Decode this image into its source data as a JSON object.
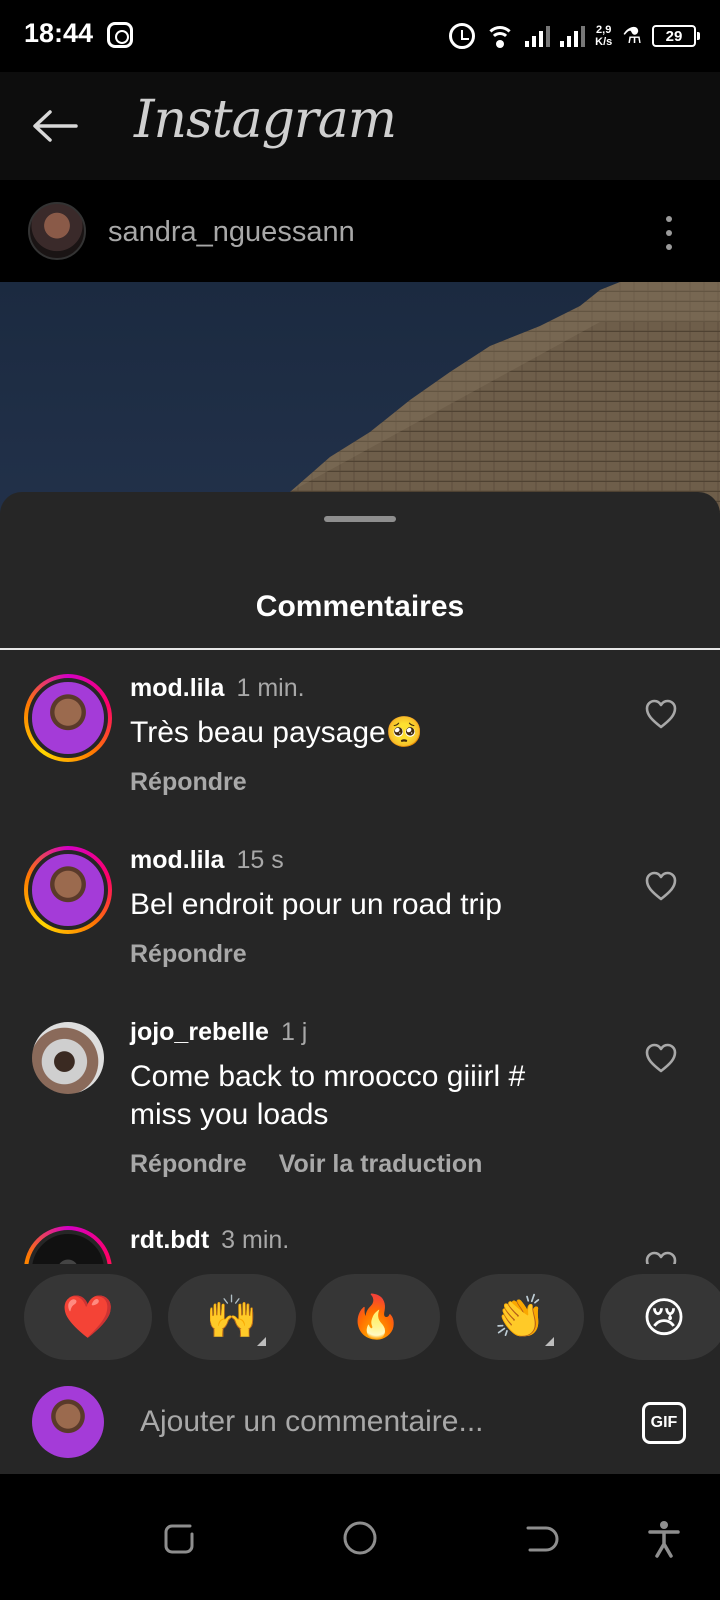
{
  "status_bar": {
    "time": "18:44",
    "net_speed_value": "2,9",
    "net_speed_unit": "K/s",
    "battery": "29"
  },
  "app": {
    "title": "Instagram"
  },
  "post": {
    "username": "sandra_nguessann"
  },
  "sheet": {
    "title": "Commentaires"
  },
  "comments": [
    {
      "username": "mod.lila",
      "time": "1 min.",
      "text": "Très beau paysage🥺",
      "actions": [
        "Répondre"
      ],
      "avatar_icon": "avatar-emoji"
    },
    {
      "username": "mod.lila",
      "time": "15 s",
      "text": "Bel endroit pour  un road trip",
      "actions": [
        "Répondre"
      ],
      "avatar_icon": "avatar-emoji"
    },
    {
      "username": "jojo_rebelle",
      "time": "1 j",
      "text": "Come back to mroocco giiirl # miss you loads",
      "actions": [
        "Répondre",
        "Voir la traduction"
      ],
      "avatar_icon": "avatar-photo"
    },
    {
      "username": "rdt.bdt",
      "time": "3 min.",
      "text": "",
      "actions": [],
      "avatar_icon": "avatar-photo"
    }
  ],
  "reactions": [
    {
      "emoji": "❤️",
      "icon": "red-heart-icon"
    },
    {
      "emoji": "🙌",
      "icon": "raising-hands-icon"
    },
    {
      "emoji": "🔥",
      "icon": "fire-icon"
    },
    {
      "emoji": "👏",
      "icon": "clapping-hands-icon"
    },
    {
      "emoji": "😢",
      "icon": "crying-face-icon"
    }
  ],
  "composer": {
    "placeholder": "Ajouter un commentaire...",
    "gif_label": "GIF"
  },
  "colors": {
    "sheet_bg": "#262626",
    "secondary_text": "#a8a8a8",
    "reaction_bg": "#363636"
  }
}
